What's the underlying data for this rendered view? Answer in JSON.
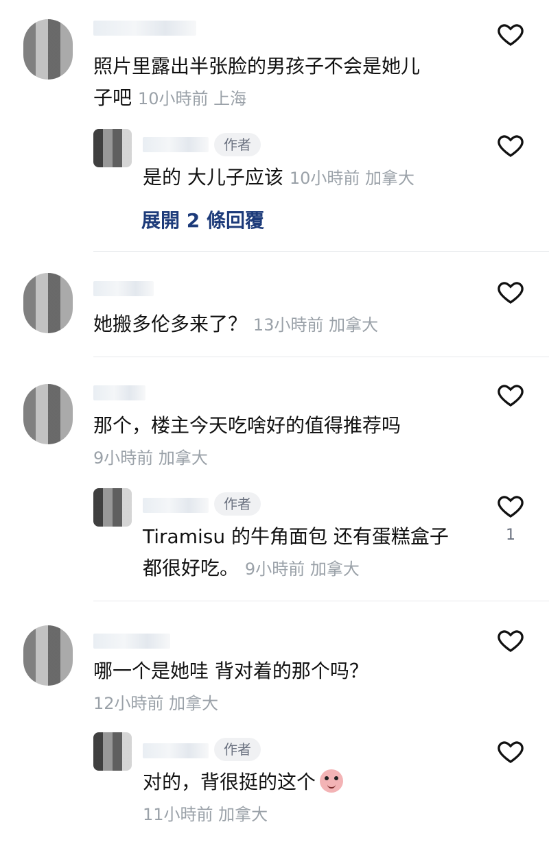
{
  "comments": [
    {
      "text_line1": "照片里露出半张脸的男孩子不会是她儿",
      "text_line2": "子吧",
      "meta": "10小時前 上海",
      "replies": [
        {
          "badge": "作者",
          "text": "是的 大儿子应该",
          "meta": "10小時前 加拿大",
          "likes": ""
        }
      ],
      "expand_label": "展開 2 條回覆"
    },
    {
      "text_line1": "她搬多伦多来了？",
      "meta": "13小時前 加拿大"
    },
    {
      "text_line1": "那个，楼主今天吃啥好的值得推荐吗",
      "meta": "9小時前 加拿大",
      "replies": [
        {
          "badge": "作者",
          "text_line1": "Tiramisu 的牛角面包 还有蛋糕盒子",
          "text_line2": "都很好吃。",
          "meta": "9小時前 加拿大",
          "likes": "1"
        }
      ]
    },
    {
      "text_line1": "哪一个是她哇 背对着的那个吗？",
      "meta": "12小時前 加拿大",
      "replies": [
        {
          "badge": "作者",
          "text": "对的，背很挺的这个",
          "meta": "11小時前 加拿大",
          "likes": ""
        }
      ]
    }
  ],
  "icons": {
    "heart": "heart-outline-icon",
    "emoji": "embarrassed-face-emoji"
  }
}
